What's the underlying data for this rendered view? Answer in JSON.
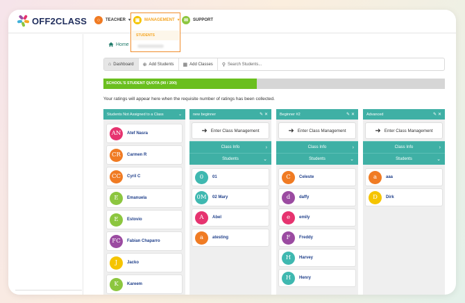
{
  "brand": {
    "name": "OFF2CLASS"
  },
  "nav": {
    "teacher": "TEACHER",
    "management": "MANAGEMENT",
    "support": "SUPPORT",
    "management_submenu": "STUDENTS"
  },
  "breadcrumb": {
    "home": "Home"
  },
  "toolbar": {
    "dashboard": "Dashboard",
    "add_students": "Add Students",
    "add_classes": "Add Classes",
    "search_placeholder": "Search Students..."
  },
  "quota": {
    "label": "SCHOOL'S STUDENT QUOTA (90 / 200)",
    "used": 90,
    "total": 200
  },
  "ratings_note": "Your ratings will appear here when the requisite number of ratings has been collected.",
  "columns": [
    {
      "title": "Students Not Assigned to a Class",
      "students": [
        {
          "initials": "AN",
          "name": "Atef Nasra",
          "color": "#e6336f"
        },
        {
          "initials": "CR",
          "name": "Carmen R",
          "color": "#f07b23"
        },
        {
          "initials": "CC",
          "name": "Cyril C",
          "color": "#f07b23"
        },
        {
          "initials": "E",
          "name": "Emanuela",
          "color": "#8cc63f"
        },
        {
          "initials": "E",
          "name": "Estovio",
          "color": "#8cc63f"
        },
        {
          "initials": "FC",
          "name": "Fabian Chaparro",
          "color": "#9b4ba1"
        },
        {
          "initials": "J",
          "name": "Jacko",
          "color": "#f5c400"
        },
        {
          "initials": "K",
          "name": "Kareem",
          "color": "#8cc63f"
        }
      ]
    },
    {
      "title": "new beginner",
      "enter_label": "Enter Class Management",
      "class_info": "Class Info",
      "students_label": "Students",
      "students": [
        {
          "initials": "0",
          "name": "01",
          "color": "#3fb8b0"
        },
        {
          "initials": "0M",
          "name": "02 Mary",
          "color": "#3fb8b0"
        },
        {
          "initials": "A",
          "name": "Abel",
          "color": "#e6336f"
        },
        {
          "initials": "a",
          "name": "atesting",
          "color": "#f07b23"
        }
      ]
    },
    {
      "title": "Beginner #2",
      "enter_label": "Enter Class Management",
      "class_info": "Class Info",
      "students_label": "Students",
      "students": [
        {
          "initials": "C",
          "name": "Celeste",
          "color": "#f07b23"
        },
        {
          "initials": "d",
          "name": "daffy",
          "color": "#9b4ba1"
        },
        {
          "initials": "e",
          "name": "emily",
          "color": "#e6336f"
        },
        {
          "initials": "F",
          "name": "Freddy",
          "color": "#9b4ba1"
        },
        {
          "initials": "H",
          "name": "Harvey",
          "color": "#3fb8b0"
        },
        {
          "initials": "H",
          "name": "Henry",
          "color": "#3fb8b0"
        }
      ]
    },
    {
      "title": "Advanced",
      "enter_label": "Enter Class Management",
      "class_info": "Class Info",
      "students_label": "Students",
      "students": [
        {
          "initials": "a",
          "name": "aaa",
          "color": "#f07b23"
        },
        {
          "initials": "D",
          "name": "Dirk",
          "color": "#f5c400"
        }
      ]
    }
  ],
  "colors": {
    "teal": "#3fb0a5",
    "quota_green": "#6abf1e",
    "accent_orange": "#f08c2a"
  }
}
